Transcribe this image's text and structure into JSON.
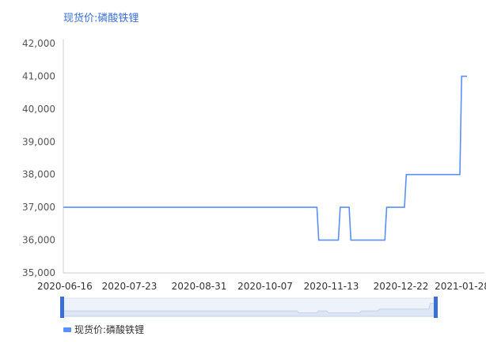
{
  "chart_data": {
    "type": "line",
    "title": "现货价:磷酸铁锂",
    "xlabel": "",
    "ylabel": "",
    "ylim": [
      35000,
      42000
    ],
    "yticks": [
      "42,000",
      "41,000",
      "40,000",
      "39,000",
      "38,000",
      "37,000",
      "36,000",
      "35,000"
    ],
    "xticks": [
      "2020-06-16",
      "2020-07-23",
      "2020-08-31",
      "2020-10-07",
      "2020-11-13",
      "2020-12-22",
      "2021-01-28"
    ],
    "series": [
      {
        "name": "现货价:磷酸铁锂",
        "color": "#5b8ff9",
        "points": [
          [
            "2020-06-16",
            37000
          ],
          [
            "2020-11-05",
            37000
          ],
          [
            "2020-11-06",
            36000
          ],
          [
            "2020-11-17",
            36000
          ],
          [
            "2020-11-18",
            37000
          ],
          [
            "2020-11-23",
            37000
          ],
          [
            "2020-11-24",
            36000
          ],
          [
            "2020-12-13",
            36000
          ],
          [
            "2020-12-14",
            37000
          ],
          [
            "2020-12-24",
            37000
          ],
          [
            "2020-12-25",
            38000
          ],
          [
            "2021-01-24",
            38000
          ],
          [
            "2021-01-25",
            41000
          ],
          [
            "2021-01-28",
            41000
          ]
        ]
      }
    ],
    "legend": {
      "position": "bottom-left",
      "label": "现货价:磷酸铁锂"
    },
    "grid": false
  }
}
